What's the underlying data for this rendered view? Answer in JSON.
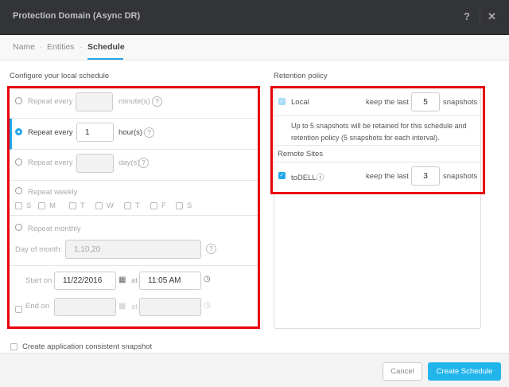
{
  "dialog": {
    "title": "Protection Domain (Async DR)",
    "help": "?",
    "close": "✕"
  },
  "steps": [
    {
      "label": "Name"
    },
    {
      "label": "Entities"
    },
    {
      "label": "Schedule"
    }
  ],
  "step_sep": "·",
  "schedule": {
    "heading": "Configure your local schedule",
    "minutes": {
      "label": "Repeat every",
      "value": "",
      "unit": "minute(s)"
    },
    "hours": {
      "label": "Repeat every",
      "value": "1",
      "unit": "hour(s)"
    },
    "days": {
      "label": "Repeat every",
      "value": "",
      "unit": "day(s)"
    },
    "weekly": {
      "label": "Repeat weekly",
      "days": [
        "S",
        "M",
        "T",
        "W",
        "T",
        "F",
        "S"
      ]
    },
    "monthly": {
      "label": "Repeat monthly",
      "day_label": "Day of month:",
      "day_placeholder": "1,10,20"
    },
    "start": {
      "label": "Start on",
      "date": "11/22/2016",
      "at": "at",
      "time": "11:05 AM"
    },
    "end": {
      "label": "End on",
      "date": "",
      "at": "at",
      "time": ""
    },
    "help": "?"
  },
  "app_consistent": {
    "label": "Create application consistent snapshot",
    "checked": false
  },
  "retention": {
    "heading": "Retention policy",
    "local": {
      "label": "Local",
      "keep": "keep the last",
      "value": "5",
      "unit": "snapshots",
      "check": "✓"
    },
    "note": "Up to 5 snapshots will be retained for this schedule and retention policy (5 snapshots for each interval).",
    "remote_heading": "Remote Sites",
    "remote": {
      "label": "toDELL",
      "info": "ⓘ",
      "keep": "keep the last",
      "value": "3",
      "unit": "snapshots",
      "check": "✓"
    }
  },
  "footer": {
    "cancel": "Cancel",
    "create": "Create Schedule"
  },
  "colors": {
    "accent": "#22a6e8",
    "highlight": "#e8000b",
    "header": "#333437"
  }
}
